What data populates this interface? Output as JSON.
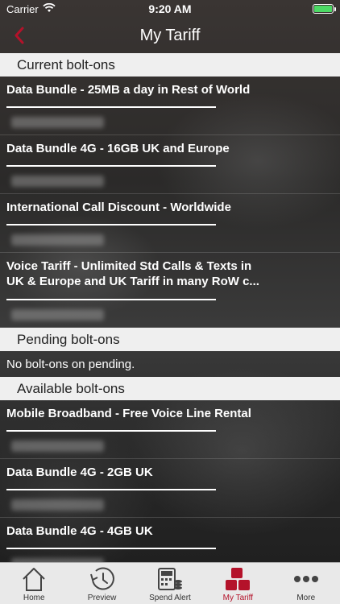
{
  "status": {
    "carrier": "Carrier",
    "time": "9:20 AM",
    "battery_level": 1.0
  },
  "nav": {
    "title": "My Tariff"
  },
  "sections": {
    "current": {
      "header": "Current bolt-ons",
      "items": [
        {
          "title": "Data Bundle - 25MB a day in Rest of World"
        },
        {
          "title": "Data Bundle 4G - 16GB UK and Europe"
        },
        {
          "title": "International Call Discount - Worldwide"
        },
        {
          "title": "Voice Tariff - Unlimited Std Calls & Texts in UK & Europe and UK Tariff in many RoW c..."
        }
      ]
    },
    "pending": {
      "header": "Pending bolt-ons",
      "message": "No bolt-ons on pending."
    },
    "available": {
      "header": "Available bolt-ons",
      "items": [
        {
          "title": "Mobile Broadband - Free Voice Line Rental"
        },
        {
          "title": "Data Bundle 4G - 2GB UK"
        },
        {
          "title": "Data Bundle 4G - 4GB UK"
        }
      ]
    }
  },
  "tabs": [
    {
      "label": "Home",
      "icon": "home-icon"
    },
    {
      "label": "Preview",
      "icon": "clock-icon"
    },
    {
      "label": "Spend Alert",
      "icon": "calculator-coins-icon"
    },
    {
      "label": "My Tariff",
      "icon": "tariff-grid-icon",
      "active": true
    },
    {
      "label": "More",
      "icon": "more-dots-icon"
    }
  ],
  "colors": {
    "accent": "#b4122a",
    "battery": "#4cd964",
    "section_bg": "#efefef"
  }
}
